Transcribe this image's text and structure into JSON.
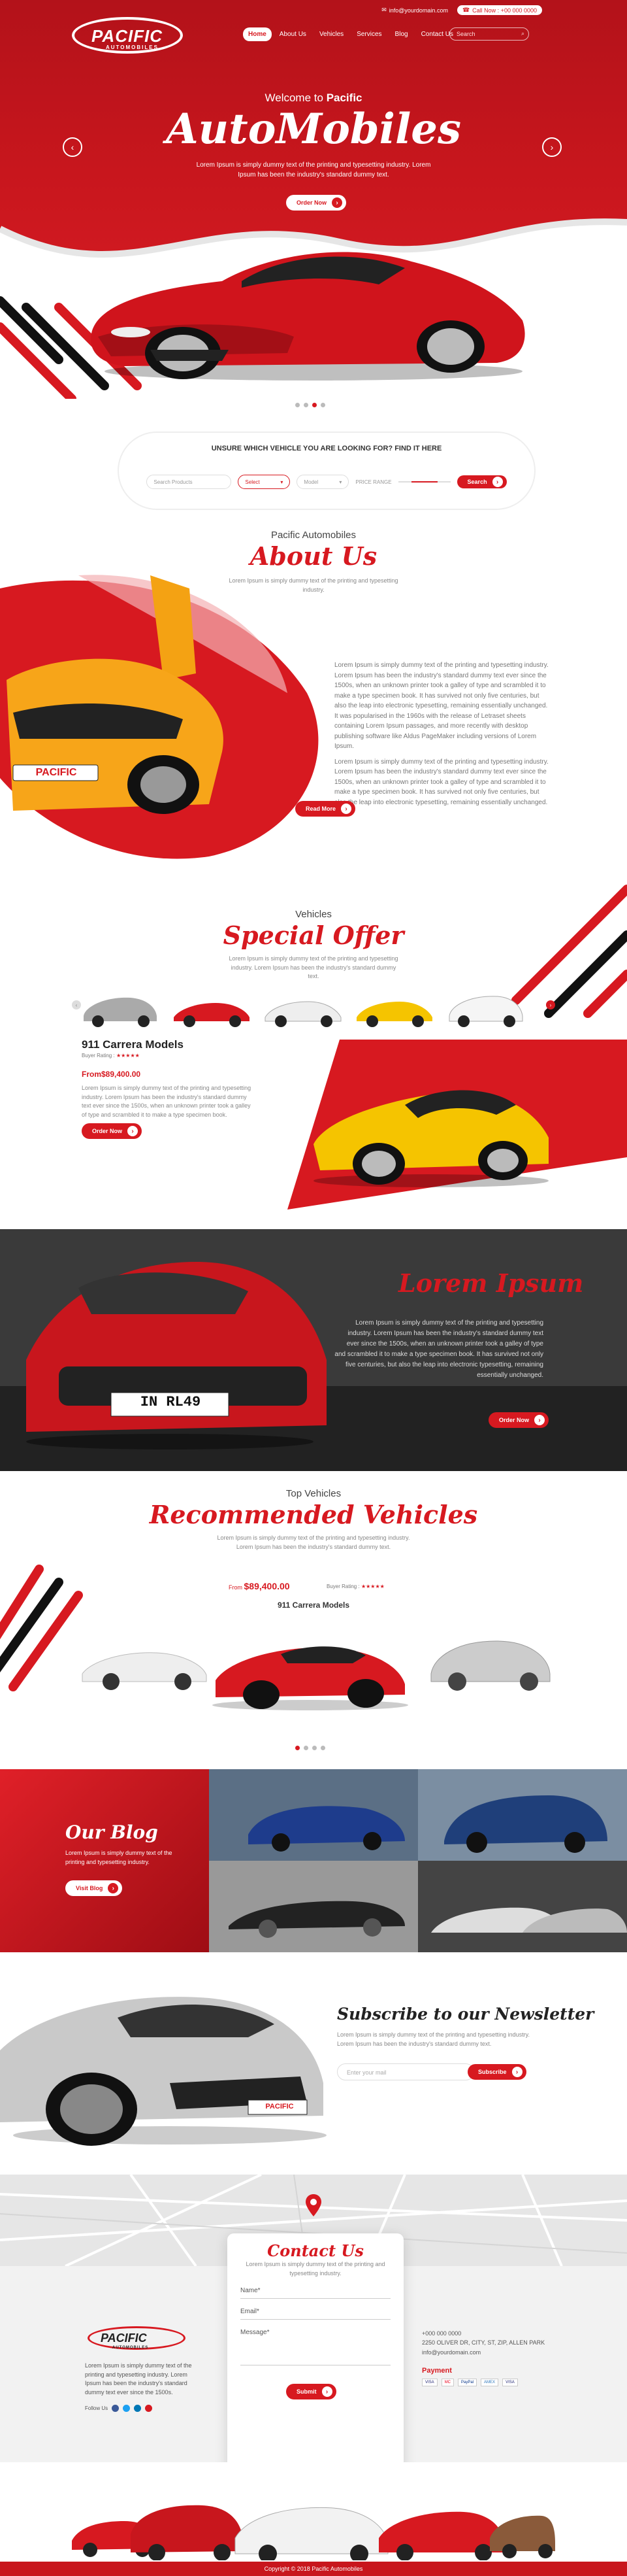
{
  "topbar": {
    "email": "info@yourdomain.com",
    "phone": "Call Now : +00 000 0000"
  },
  "logo": {
    "name": "PACIFIC",
    "tagline": "AUTOMOBILES"
  },
  "nav": {
    "items": [
      "Home",
      "About Us",
      "Vehicles",
      "Services",
      "Blog",
      "Contact Us"
    ]
  },
  "header_search": {
    "placeholder": "Search"
  },
  "hero": {
    "welcome_prefix": "Welcome to",
    "welcome_brand": "Pacific",
    "title": "AutoMobiles",
    "description": "Lorem Ipsum is simply dummy text of the printing and typesetting industry. Lorem Ipsum has been the industry's standard dummy text.",
    "button": "Order Now",
    "slide_count": 4,
    "active_slide": 3
  },
  "search": {
    "heading": "UNSURE WHICH VEHICLE YOU ARE LOOKING FOR? FIND IT HERE",
    "keyword_placeholder": "Search Products",
    "select1": "Select",
    "select2": "Model",
    "price_label": "PRICE RANGE",
    "button": "Search"
  },
  "about": {
    "subheading": "Pacific Automobiles",
    "heading": "About Us",
    "intro": "Lorem Ipsum is simply dummy text of the printing and typesetting industry.",
    "para1": "Lorem Ipsum is simply dummy text of the printing and typesetting industry. Lorem Ipsum has been the industry's standard dummy text ever since the 1500s, when an unknown printer took a galley of type and scrambled it to make a type specimen book. It has survived not only five centuries, but also the leap into electronic typesetting, remaining essentially unchanged. It was popularised in the 1960s with the release of Letraset sheets containing Lorem Ipsum passages, and more recently with desktop publishing software like Aldus PageMaker including versions of Lorem Ipsum.",
    "para2": "Lorem Ipsum is simply dummy text of the printing and typesetting industry. Lorem Ipsum has been the industry's standard dummy text ever since the 1500s, when an unknown printer took a galley of type and scrambled it to make a type specimen book. It has survived not only five centuries, but also the leap into electronic typesetting, remaining essentially unchanged.",
    "button": "Read More",
    "plate": "PACIFIC"
  },
  "offer": {
    "subheading": "Vehicles",
    "heading": "Special Offer",
    "intro": "Lorem Ipsum is simply dummy text of the printing and typesetting industry. Lorem Ipsum has been the industry's standard dummy text.",
    "model": "911 Carrera Models",
    "rating_label": "Buyer Rating :",
    "stars": "★★★★★",
    "price": "From$89,400.00",
    "description": "Lorem Ipsum is simply dummy text of the printing and typesetting industry. Lorem Ipsum has been the industry's standard dummy text ever since the 1500s, when an unknown printer took a galley of type and scrambled it to make a type specimen book.",
    "button": "Order Now"
  },
  "lorem": {
    "heading": "Lorem Ipsum",
    "text": "Lorem Ipsum is simply dummy text of the printing and typesetting industry. Lorem Ipsum has been the industry's standard dummy text ever since the 1500s, when an unknown printer took a galley of type and scrambled it to make a type specimen book. It has survived not only five centuries, but also the leap into electronic typesetting, remaining essentially unchanged.",
    "button": "Order Now",
    "plate": "IN RL49"
  },
  "recommended": {
    "subheading": "Top Vehicles",
    "heading": "Recommended Vehicles",
    "intro": "Lorem Ipsum is simply dummy text of the printing and typesetting industry. Lorem Ipsum has been the industry's standard dummy text.",
    "price_prefix": "From",
    "price": "$89,400.00",
    "rating_label": "Buyer Rating :",
    "stars": "★★★★★",
    "model": "911 Carrera Models",
    "slide_count": 4,
    "active_slide": 1
  },
  "blog": {
    "heading": "Our Blog",
    "text": "Lorem Ipsum is simply dummy text of the printing and typesetting industry.",
    "button": "Visit Blog"
  },
  "newsletter": {
    "heading": "Subscribe to our Newsletter",
    "text": "Lorem Ipsum is simply dummy text of the printing and typesetting industry. Lorem Ipsum has been the industry's standard dummy text.",
    "placeholder": "Enter your mail",
    "button": "Subscribe",
    "badge": "PACIFIC"
  },
  "contact": {
    "heading": "Contact Us",
    "intro": "Lorem Ipsum is simply dummy text of the printing and typesetting industry.",
    "name_label": "Name*",
    "email_label": "Email*",
    "message_label": "Message*",
    "button": "Submit"
  },
  "footer": {
    "about": "Lorem Ipsum is simply dummy text of the printing and typesetting industry. Lorem Ipsum has been the industry's standard dummy text ever since the 1500s.",
    "follow": "Follow Us",
    "phone": "+000 000 0000",
    "address": "2250 OLIVER DR, CITY, ST, ZIP, ALLEN PARK",
    "email": "info@yourdomain.com",
    "payment_label": "Payment",
    "payment_cards": [
      "VISA",
      "MC",
      "PayPal",
      "AMEX",
      "VISA"
    ],
    "copyright": "Copyright © 2018 Pacific Automobiles"
  },
  "colors": {
    "brand_red": "#d71920",
    "dark_red": "#b3121a",
    "yellow": "#f5c400"
  }
}
